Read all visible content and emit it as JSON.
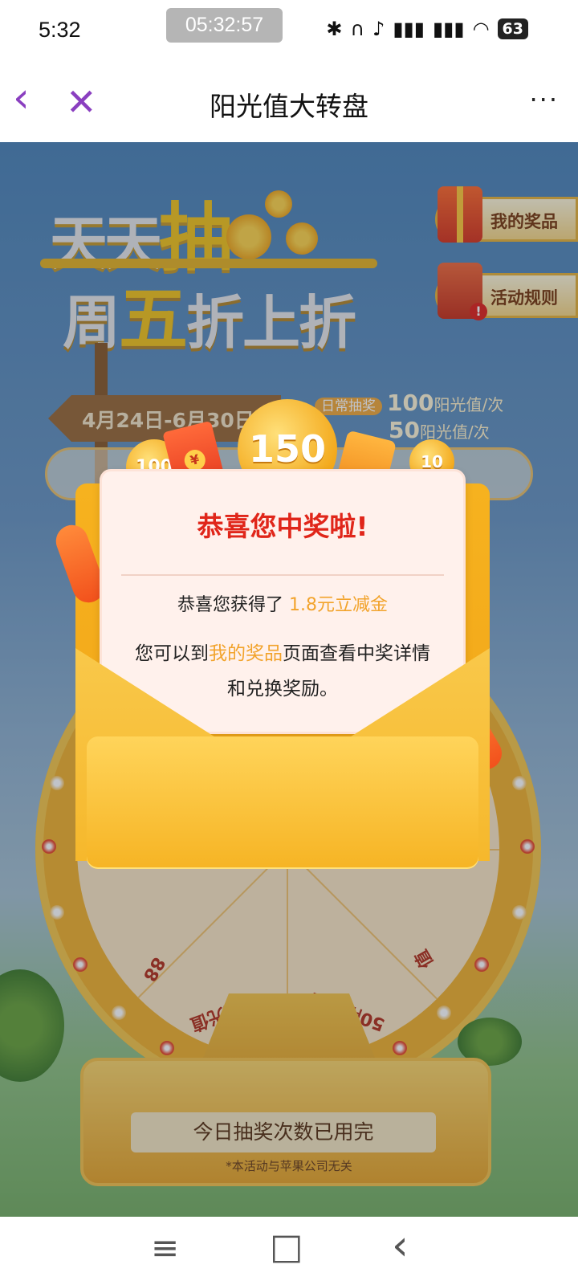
{
  "status_bar": {
    "time": "5:32",
    "recording_timer": "05:32:57",
    "icons": [
      "bluetooth-icon",
      "headphones-icon",
      "mute-icon",
      "signal-4g-icon",
      "signal-4g-icon",
      "wifi-icon"
    ],
    "battery": "63"
  },
  "title_bar": {
    "title": "阳光值大转盘",
    "back_icon": "‹",
    "close_icon": "✕",
    "more_icon": "···"
  },
  "hero": {
    "line1_a": "天天",
    "line1_b": "抽",
    "line2_a": "周",
    "line2_b": "五",
    "line2_c": "折上折"
  },
  "side_buttons": {
    "my_prizes": "我的奖品",
    "rules": "活动规则"
  },
  "activity_info": {
    "date_range": "4月24日-6月30日",
    "daily_tag": "日常抽奖",
    "daily_cost_num": "100",
    "cost_unit": "阳光值/次",
    "friday_cost_num": "50"
  },
  "coins": {
    "coin_small": "100",
    "coin_big": "150",
    "coin_right": "10"
  },
  "popup": {
    "title": "恭喜您中奖啦!",
    "line1_prefix": "恭喜您获得了",
    "line1_prize": "1.8元立减金",
    "line2_prefix": "您可以到",
    "line2_link": "我的奖品",
    "line2_suffix": "页面查看中奖详情和兑换奖励。"
  },
  "wheel": {
    "prize_left": "10阳光值",
    "prize_right": "50阳光值",
    "prize_far_left": "88",
    "prize_far_right": "值"
  },
  "bottom": {
    "draw_status": "今日抽奖次数已用完",
    "disclaimer": "*本活动与苹果公司无关"
  },
  "nav_bar": {
    "menu_icon": "≡",
    "home_icon": "□",
    "back_icon": "‹"
  },
  "colors": {
    "accent_purple": "#8a3fc0",
    "popup_title_red": "#e0261a",
    "highlight_orange": "#f2a32b",
    "envelope_gold": "#f6b21f"
  }
}
